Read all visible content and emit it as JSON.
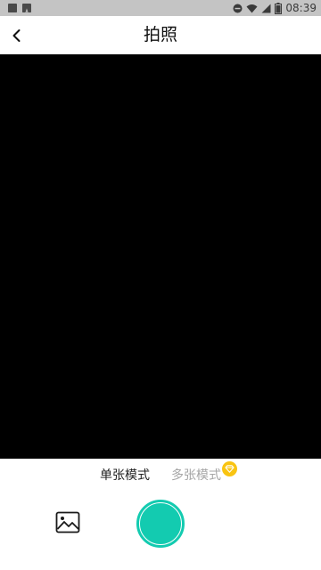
{
  "status_bar": {
    "time": "08:39",
    "icons": [
      "image-notification-icon",
      "text-notification-icon",
      "do-not-disturb-icon",
      "wifi-icon",
      "signal-icon",
      "battery-icon"
    ]
  },
  "header": {
    "title": "拍照",
    "back_icon": "chevron-left-icon"
  },
  "modes": {
    "single_label": "单张模式",
    "multi_label": "多张模式",
    "multi_badge_icon": "diamond-icon"
  },
  "controls": {
    "gallery_icon": "image-icon",
    "shutter": "shutter-button"
  },
  "colors": {
    "status_bar": "#c4c4c4",
    "preview": "#000000",
    "accent": "#13cbb0",
    "badge": "#f9c412",
    "inactive_text": "#a6a6a6"
  }
}
